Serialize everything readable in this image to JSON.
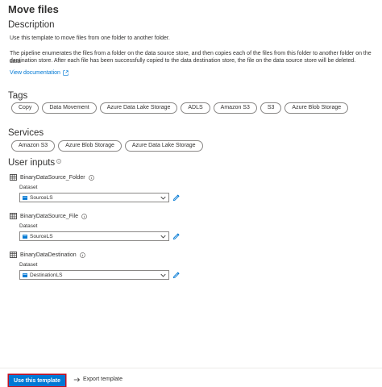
{
  "header": {
    "title": "Move files"
  },
  "description": {
    "heading": "Description",
    "line1": "Use this template to move files from one folder to another folder.",
    "para2_line1": "The pipeline enumerates the files from a folder on the data source store, and then copies each of the files from this folder to another folder on the data",
    "para2_line2": "destination store. After each file has been successfully copied to the data destination store, the file on the data source store will be deleted.",
    "link_label": "View documentation"
  },
  "tags": {
    "heading": "Tags",
    "items": [
      "Copy",
      "Data Movement",
      "Azure Data Lake Storage",
      "ADLS",
      "Amazon S3",
      "S3",
      "Azure Blob Storage"
    ]
  },
  "services": {
    "heading": "Services",
    "items": [
      "Amazon S3",
      "Azure Blob Storage",
      "Azure Data Lake Storage"
    ]
  },
  "user_inputs": {
    "heading": "User inputs",
    "items": [
      {
        "name": "BinaryDataSource_Folder",
        "field_label": "Dataset",
        "value": "SourceLS"
      },
      {
        "name": "BinaryDataSource_File",
        "field_label": "Dataset",
        "value": "SourceLS"
      },
      {
        "name": "BinaryDataDestination",
        "field_label": "Dataset",
        "value": "DestinationLS"
      }
    ]
  },
  "footer": {
    "primary_label": "Use this template",
    "export_label": "Export template"
  },
  "colors": {
    "accent": "#0078d4",
    "focus_outline": "#c50f1f"
  },
  "icons": [
    "external-link-icon",
    "info-icon",
    "dataset-grid-icon",
    "chevron-down-icon",
    "pencil-icon",
    "linked-service-icon",
    "export-arrow-icon"
  ]
}
